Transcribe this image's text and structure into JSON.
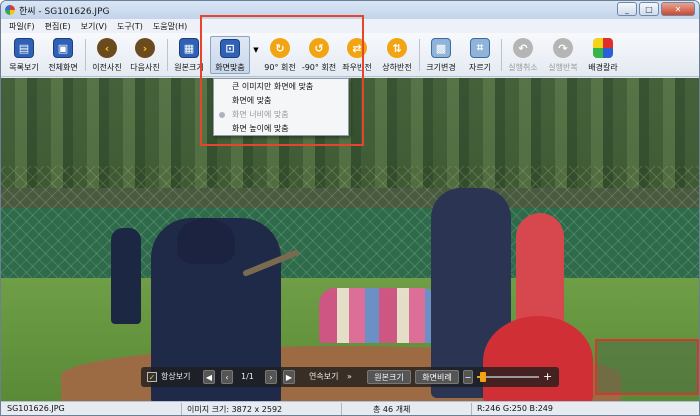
{
  "window": {
    "title": "한씨 - SG101626.JPG"
  },
  "menu": [
    "파일(F)",
    "편집(E)",
    "보기(V)",
    "도구(T)",
    "도움말(H)"
  ],
  "toolbar": {
    "list_view": "목록보기",
    "fullscreen": "전체화면",
    "prev": "이전사진",
    "next": "다음사진",
    "original": "원본크기",
    "fit": "화면맞춤",
    "rotate90": "90° 회전",
    "rotate_neg90": "-90° 회전",
    "flip_h": "좌우반전",
    "flip_v": "상하반전",
    "resize": "크기변경",
    "crop": "자르기",
    "undo": "실행취소",
    "redo": "실행반복",
    "bgcolor": "배경칼라"
  },
  "dropdown": {
    "items": [
      {
        "label": "큰 이미지만 화면에 맞춤",
        "disabled": false,
        "selected": false
      },
      {
        "label": "화면에 맞춤",
        "disabled": false,
        "selected": false
      },
      {
        "label": "화면 너비에 맞춤",
        "disabled": true,
        "selected": true
      },
      {
        "label": "화면 높이에 맞춤",
        "disabled": false,
        "selected": false
      }
    ]
  },
  "overlay": {
    "always_on_top": "항상보기",
    "page": "1/1",
    "slideshow": "연속보기",
    "original": "원본크기",
    "fit_ratio": "화면비례",
    "zoom_level": 0.1
  },
  "status": {
    "filename": "SG101626.JPG",
    "image_size": "이미지 크기: 3872 x 2592",
    "count": "총 46 개체",
    "color": "R:246 G:250 B:249"
  },
  "colors": {
    "highlight": "#e8432d",
    "titlebar": "#c2d4ea",
    "accent": "#f2a413"
  },
  "icons": {
    "list_view": "frame-icon",
    "prev": "chevron-left-icon",
    "next": "chevron-right-icon",
    "rotate": "rotate-icon",
    "bgcolor": "palette-icon"
  }
}
